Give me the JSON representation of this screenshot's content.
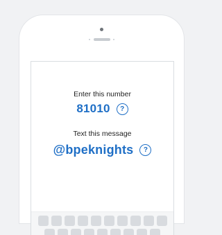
{
  "enter_label": "Enter this number",
  "number": "81010",
  "text_label": "Text this message",
  "message": "@bpeknights",
  "help_glyph": "?",
  "colors": {
    "accent": "#1f6fc6",
    "background": "#f1f2f4",
    "key": "#d8dbdf"
  }
}
